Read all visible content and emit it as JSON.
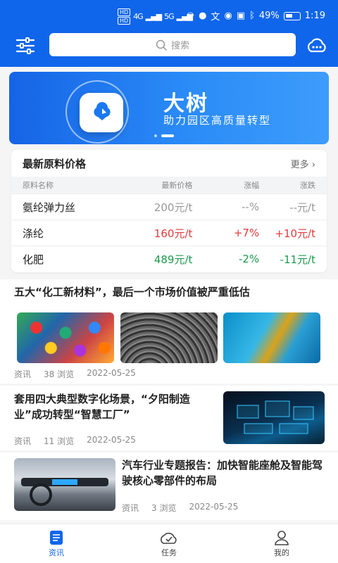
{
  "status_bar": {
    "signal_left": "HD",
    "signal_a": "4G",
    "signal_b": "5G",
    "battery_pct": "49%",
    "time": "1:19"
  },
  "toolbar": {
    "search_placeholder": "搜索"
  },
  "banner": {
    "title": "大树",
    "subtitle": "助力园区高质量转型",
    "active_dot": 1
  },
  "price": {
    "title": "最新原料价格",
    "more": "更多",
    "columns": [
      "原料名称",
      "最新价格",
      "涨幅",
      "涨跌"
    ],
    "rows": [
      {
        "name": "氨纶弹力丝",
        "price": "200元/t",
        "pct": "--%",
        "change": "--元/t",
        "color": "#999999"
      },
      {
        "name": "涤纶",
        "price": "160元/t",
        "pct": "+7%",
        "change": "+10元/t",
        "color": "#e23a3a"
      },
      {
        "name": "化肥",
        "price": "489元/t",
        "pct": "-2%",
        "change": "-11元/t",
        "color": "#1b9a4a"
      }
    ]
  },
  "news": [
    {
      "title": "五大“化工新材料”，最后一个市场价值被严重低估",
      "type": "资讯",
      "views": "38 浏览",
      "date": "2022-05-25"
    },
    {
      "title": "套用四大典型数字化场景，“夕阳制造业”成功转型“智慧工厂”",
      "type": "资讯",
      "views": "11 浏览",
      "date": "2022-05-25"
    },
    {
      "title": "汽车行业专题报告：加快智能座舱及智能驾驶核心零部件的布局",
      "type": "资讯",
      "views": "3 浏览",
      "date": "2022-05-25"
    }
  ],
  "tabs": [
    {
      "label": "资讯",
      "icon": "news-icon"
    },
    {
      "label": "任务",
      "icon": "task-icon"
    },
    {
      "label": "我的",
      "icon": "profile-icon"
    }
  ],
  "colors": {
    "primary": "#0f66ea",
    "up": "#e23a3a",
    "down": "#1b9a4a"
  }
}
